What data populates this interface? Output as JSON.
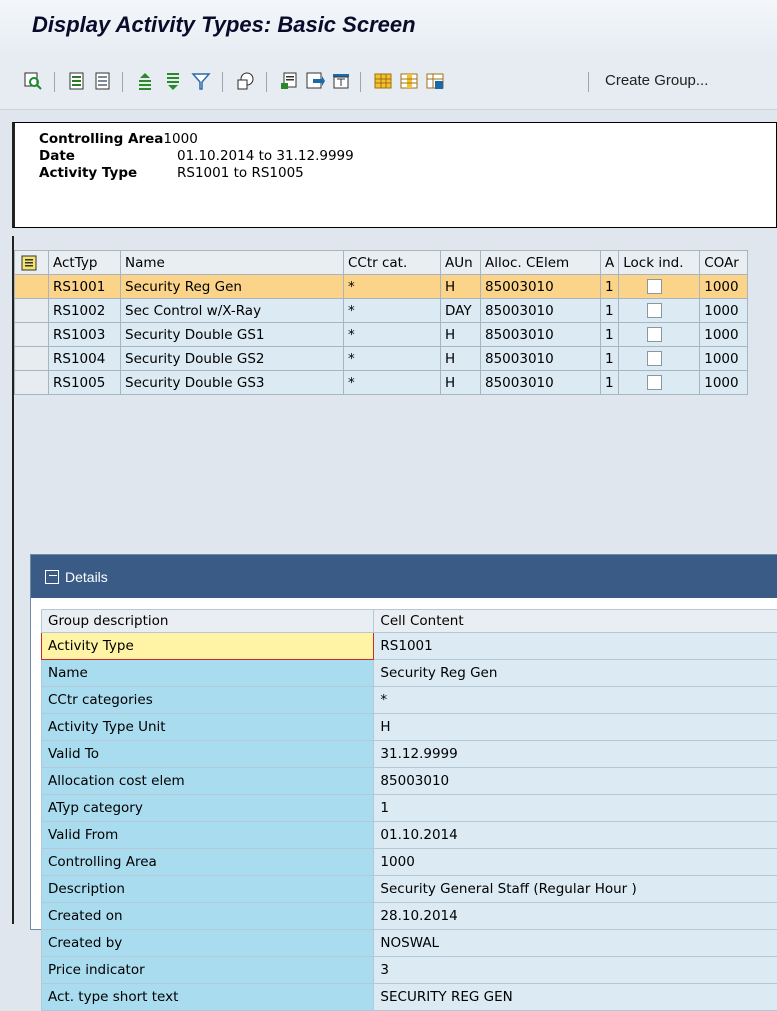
{
  "window": {
    "title": "Display Activity Types: Basic Screen"
  },
  "toolbar": {
    "buttons": [
      "search-icon",
      "select-all-icon",
      "deselect-all-icon",
      "sort-ascending-icon",
      "sort-descending-icon",
      "filter-icon",
      "details-icon",
      "export-icon",
      "save-icon",
      "print-icon",
      "grid-layout-icon",
      "change-layout-icon",
      "save-layout-icon"
    ],
    "create_group_label": "Create Group..."
  },
  "header": {
    "controlling_area_label": "Controlling Area",
    "controlling_area_value": "1000",
    "date_label": "Date",
    "date_value": "01.10.2014 to 31.12.9999",
    "activity_type_label": "Activity Type",
    "activity_type_value": "RS1001 to RS1005"
  },
  "grid": {
    "columns": [
      "ActTyp",
      "Name",
      "CCtr cat.",
      "AUn",
      "Alloc. CElem",
      "A",
      "Lock ind.",
      "COAr"
    ],
    "rows": [
      [
        "RS1001",
        "Security Reg Gen",
        "*",
        "H",
        "85003010",
        "1",
        "",
        "1000"
      ],
      [
        "RS1002",
        "Sec Control w/X-Ray",
        "*",
        "DAY",
        "85003010",
        "1",
        "",
        "1000"
      ],
      [
        "RS1003",
        "Security  Double GS1",
        "*",
        "H",
        "85003010",
        "1",
        "",
        "1000"
      ],
      [
        "RS1004",
        "Security  Double GS2",
        "*",
        "H",
        "85003010",
        "1",
        "",
        "1000"
      ],
      [
        "RS1005",
        "Security  Double GS3",
        "*",
        "H",
        "85003010",
        "1",
        "",
        "1000"
      ]
    ],
    "selected_row": 0
  },
  "details": {
    "title": "Details",
    "col_group": "Group description",
    "col_content": "Cell Content",
    "rows": [
      [
        "Activity Type",
        "RS1001"
      ],
      [
        "Name",
        "Security Reg Gen"
      ],
      [
        "CCtr categories",
        "*"
      ],
      [
        "Activity Type Unit",
        "H"
      ],
      [
        "Valid To",
        "31.12.9999"
      ],
      [
        "Allocation cost elem",
        "85003010"
      ],
      [
        "ATyp category",
        "1"
      ],
      [
        "Valid From",
        "01.10.2014"
      ],
      [
        "Controlling Area",
        "1000"
      ],
      [
        "Description",
        "Security General Staff (Regular Hour )"
      ],
      [
        "Created on",
        "28.10.2014"
      ],
      [
        "Created by",
        "NOSWAL"
      ],
      [
        "Price indicator",
        "3"
      ],
      [
        "Act. type short text",
        "SECURITY REG GEN"
      ]
    ]
  }
}
